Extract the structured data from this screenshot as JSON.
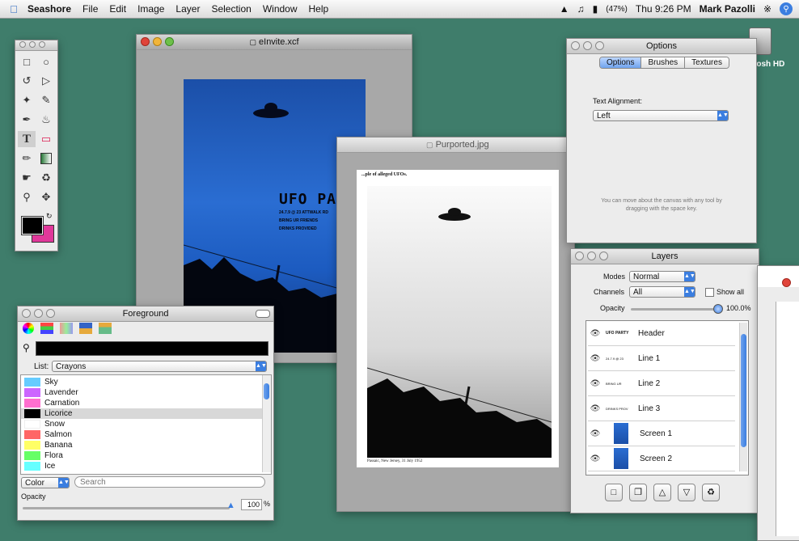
{
  "menubar": {
    "app_name": "Seashore",
    "items": [
      "File",
      "Edit",
      "Image",
      "Layer",
      "Selection",
      "Window",
      "Help"
    ],
    "battery": "(47%)",
    "clock": "Thu 9:26 PM",
    "user": "Mark Pazolli"
  },
  "desktop": {
    "hd_label": "tosh HD"
  },
  "invite_window": {
    "title": "eInvite.xcf",
    "poster_title": "UFO PARTY",
    "poster_lines": [
      "24.7.9 @ 23 ATTWALK RD",
      "BRING UR FRIENDS",
      "DRINKS PROVIDED"
    ]
  },
  "purported_window": {
    "title": "Purported.jpg",
    "top_caption": "...ple of alleged UFOs.",
    "bottom_caption": "Passaic, New Jersey, 31 July 1952"
  },
  "options_window": {
    "title": "Options",
    "tabs": [
      "Options",
      "Brushes",
      "Textures"
    ],
    "text_alignment_label": "Text Alignment:",
    "alignment_value": "Left",
    "hint": "You can move about the canvas with any tool by dragging with the space key."
  },
  "layers_window": {
    "title": "Layers",
    "modes_label": "Modes",
    "modes_value": "Normal",
    "channels_label": "Channels",
    "channels_value": "All",
    "show_all_label": "Show all",
    "opacity_label": "Opacity",
    "opacity_value": "100.0%",
    "layers": [
      {
        "name": "Header",
        "thumb_text": "UFO PARTY"
      },
      {
        "name": "Line 1",
        "thumb_text": "24.7.9 @ 23"
      },
      {
        "name": "Line 2",
        "thumb_text": "BRING UR"
      },
      {
        "name": "Line 3",
        "thumb_text": "DRINKS PROV"
      },
      {
        "name": "Screen 1",
        "thumb_text": ""
      },
      {
        "name": "Screen 2",
        "thumb_text": ""
      }
    ]
  },
  "foreground_window": {
    "title": "Foreground",
    "list_label": "List:",
    "list_value": "Crayons",
    "colors": [
      {
        "name": "Sky",
        "hex": "#66ccff"
      },
      {
        "name": "Lavender",
        "hex": "#cc66ff"
      },
      {
        "name": "Carnation",
        "hex": "#ff6fcf"
      },
      {
        "name": "Licorice",
        "hex": "#000000"
      },
      {
        "name": "Snow",
        "hex": "#ffffff"
      },
      {
        "name": "Salmon",
        "hex": "#ff6666"
      },
      {
        "name": "Banana",
        "hex": "#ffff66"
      },
      {
        "name": "Flora",
        "hex": "#66ff66"
      },
      {
        "name": "Ice",
        "hex": "#66ffff"
      }
    ],
    "color_mode": "Color",
    "search_placeholder": "Search",
    "opacity_label": "Opacity",
    "opacity_value": "100",
    "opacity_unit": "%"
  },
  "colors": {
    "desktop": "#3f7d6b",
    "poster_blue": "#1f5fc8",
    "foreground_swatch": "#000000",
    "background_swatch": "#e0389a"
  }
}
